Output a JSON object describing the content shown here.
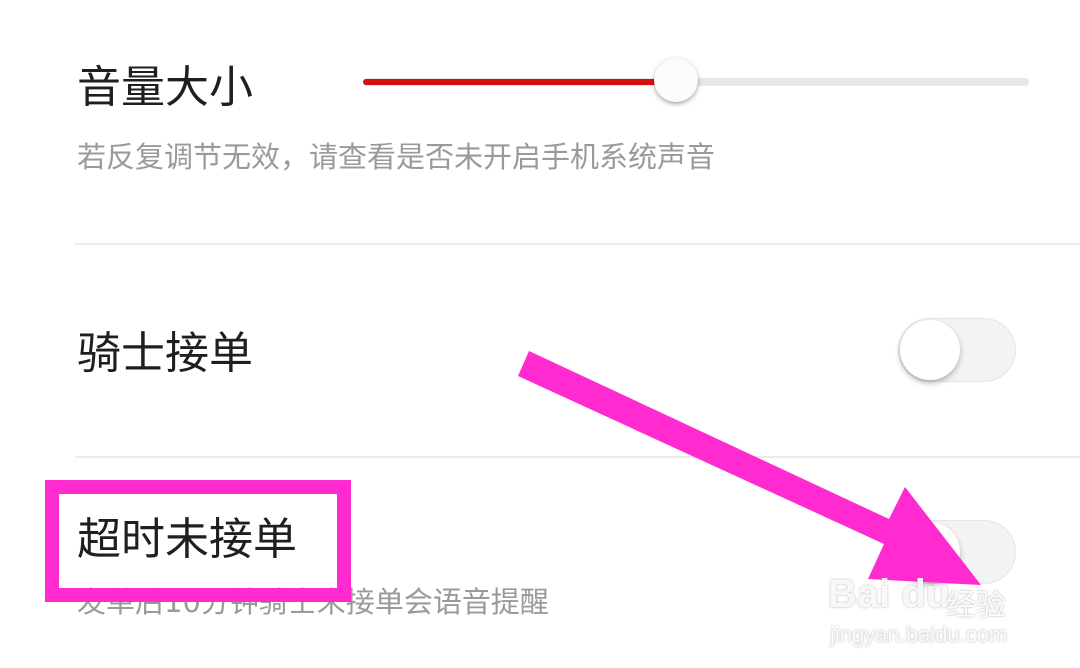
{
  "volume": {
    "title": "音量大小",
    "hint": "若反复调节无效，请查看是否未开启手机系统声音",
    "level_percent": 47,
    "fill_color": "#d40f0f"
  },
  "rider_accept": {
    "title": "骑士接单",
    "enabled": false
  },
  "timeout_unaccepted": {
    "title": "超时未接单",
    "hint": "发单后10分钟骑士未接单会语音提醒",
    "enabled": false
  },
  "annotation": {
    "highlight_color": "#ff2ad0",
    "arrow_color": "#ff2ad0"
  },
  "watermark": {
    "brand": "Bai du",
    "product": "经验",
    "url": "jingyan.baidu.com"
  }
}
